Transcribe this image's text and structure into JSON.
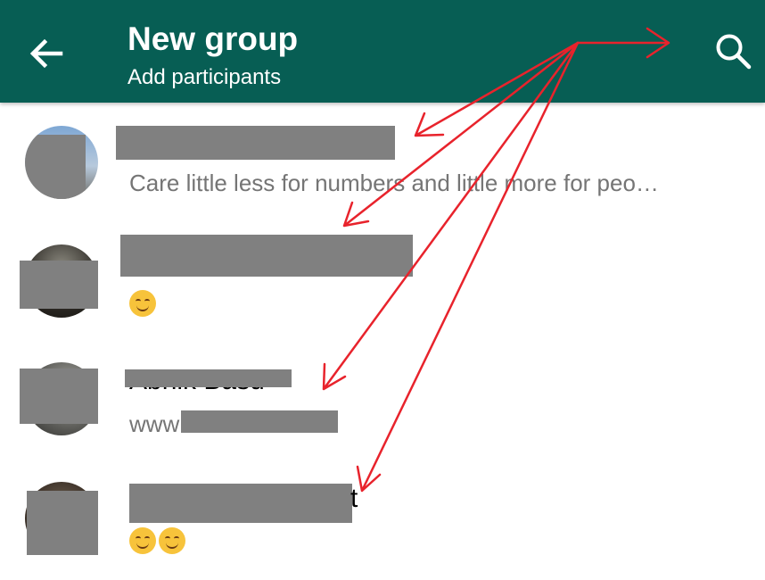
{
  "header": {
    "title": "New group",
    "subtitle": "Add participants",
    "back_icon": "arrow-left-icon",
    "search_icon": "search-icon"
  },
  "contacts": [
    {
      "name": "",
      "status": "Care little less for numbers and little more for peo…",
      "emoji_count": 0
    },
    {
      "name": "",
      "status": "",
      "emoji_count": 1
    },
    {
      "name": "Abhik Basu",
      "status": "www",
      "emoji_count": 0
    },
    {
      "name": "t",
      "status": "",
      "emoji_count": 2
    }
  ],
  "colors": {
    "appbar": "#075e54",
    "annotation": "#e8232c",
    "redaction": "#808080"
  }
}
